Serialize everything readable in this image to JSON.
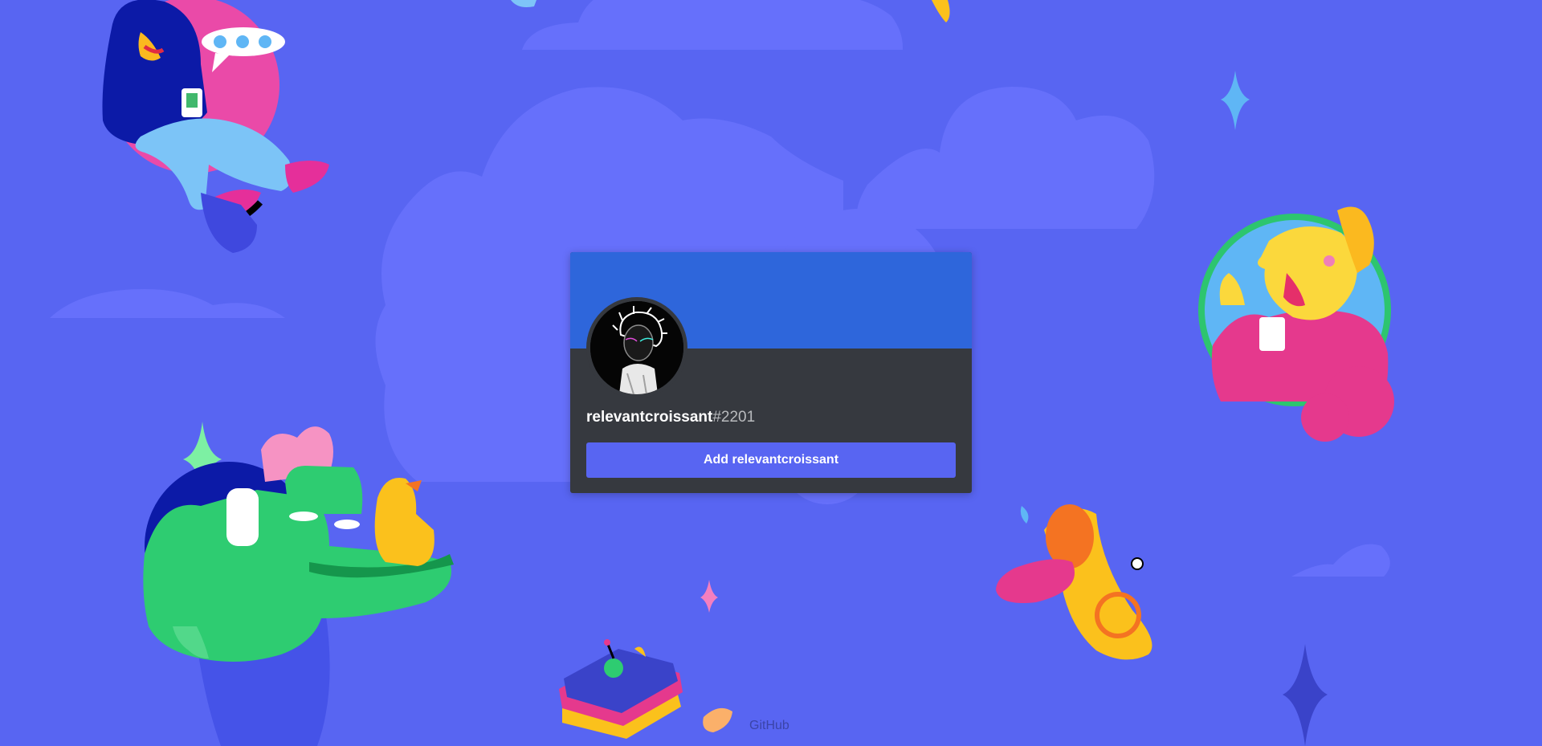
{
  "colors": {
    "background": "#5865f2",
    "banner": "#2e66db",
    "card": "#36393f",
    "button": "#5865f2",
    "username_text": "#ffffff",
    "discriminator_text": "#b9bbbe",
    "footer_link": "#3b44a8"
  },
  "profile": {
    "username": "relevantcroissant",
    "discriminator": "#2201",
    "avatar_icon": "glitch-portrait-avatar"
  },
  "actions": {
    "add_label": "Add relevantcroissant"
  },
  "footer": {
    "link_label": "GitHub"
  },
  "illustrations": [
    "person-in-chair-illustration",
    "waving-yellow-character-illustration",
    "green-dinosaur-with-duck-illustration",
    "gramophone-horn-illustration",
    "sandwich-robot-illustration"
  ]
}
